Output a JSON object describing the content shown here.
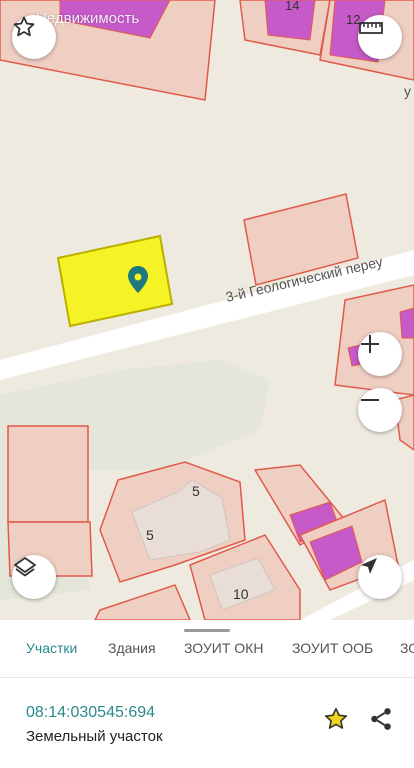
{
  "map": {
    "watermark": "Недвижимость",
    "street_label": "3-й Геологический переу",
    "street_label_cut": "у",
    "house_numbers": [
      "14",
      "12",
      "5",
      "5",
      "10"
    ]
  },
  "tabs": [
    {
      "label": "Участки",
      "active": true
    },
    {
      "label": "Здания",
      "active": false
    },
    {
      "label": "ЗОУИТ ОКН",
      "active": false
    },
    {
      "label": "ЗОУИТ ООБ",
      "active": false
    },
    {
      "label": "ЗО",
      "active": false
    }
  ],
  "parcel": {
    "cadastral_number": "08:14:030545:694",
    "type": "Земельный участок"
  },
  "colors": {
    "accent": "#2a8a8a",
    "parcel_fill": "#f5f226",
    "building_fill": "#c65ac8",
    "boundary": "#e05a4a"
  },
  "icons": {
    "favorite_map": "star-outline-icon",
    "ruler": "ruler-icon",
    "zoom_in": "plus-icon",
    "zoom_out": "minus-icon",
    "layers": "layers-icon",
    "locate": "navigation-arrow-icon",
    "favorite": "star-icon",
    "share": "share-icon",
    "marker": "location-pin-icon"
  }
}
